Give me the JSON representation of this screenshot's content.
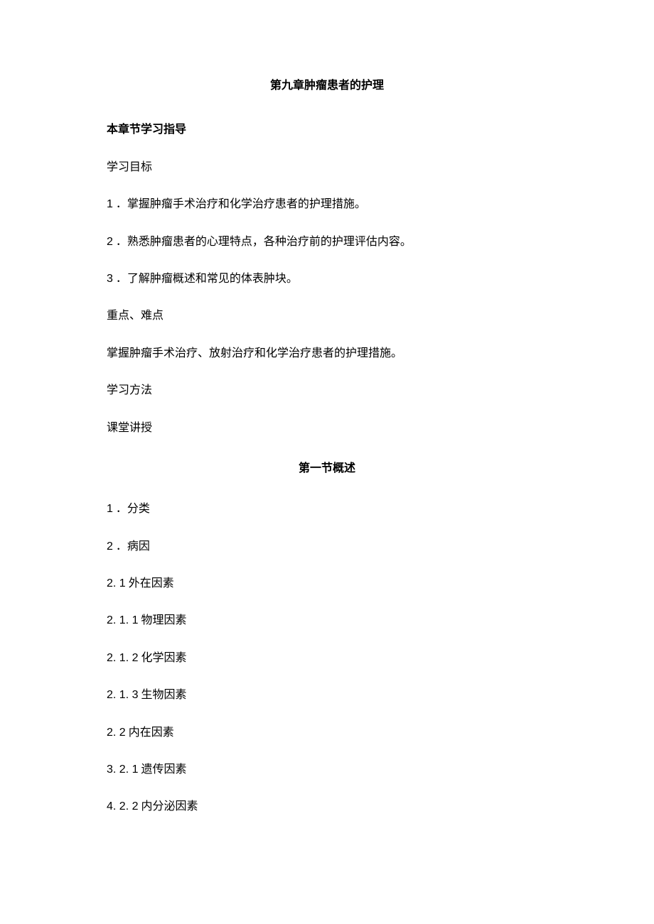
{
  "chapter_title": "第九章肿瘤患者的护理",
  "guide_heading": "本章节学习指导",
  "objectives_heading": "学习目标",
  "objectives": [
    {
      "num": "1",
      "sep": " ．",
      "text": "掌握肿瘤手术治疗和化学治疗患者的护理措施。"
    },
    {
      "num": "2",
      "sep": "  ．",
      "text": "熟悉肿瘤患者的心理特点，各种治疗前的护理评估内容。"
    },
    {
      "num": "3",
      "sep": "  ．",
      "text": "了解肿瘤概述和常见的体表肿块。"
    }
  ],
  "key_points_heading": "重点、难点",
  "key_points_text": "掌握肿瘤手术治疗、放射治疗和化学治疗患者的护理措施。",
  "method_heading": "学习方法",
  "method_text": "课堂讲授",
  "section1_title": "第一节概述",
  "outline": [
    {
      "num": "1",
      "sep": "  ．",
      "text": "分类"
    },
    {
      "num": "2",
      "sep": "   ．",
      "text": "病因"
    },
    {
      "num": "2. 1",
      "sep": " ",
      "text": "外在因素"
    },
    {
      "num": "2. 1. 1",
      "sep": " ",
      "text": "物理因素"
    },
    {
      "num": "2. 1. 2",
      "sep": " ",
      "text": "化学因素"
    },
    {
      "num": "2. 1. 3",
      "sep": " ",
      "text": "生物因素"
    },
    {
      "num": "2.    2",
      "sep": " ",
      "text": "内在因素"
    },
    {
      "num": "3.    2. 1",
      "sep": " ",
      "text": "遗传因素"
    },
    {
      "num": "4.    2. 2",
      "sep": " ",
      "text": "内分泌因素"
    }
  ]
}
